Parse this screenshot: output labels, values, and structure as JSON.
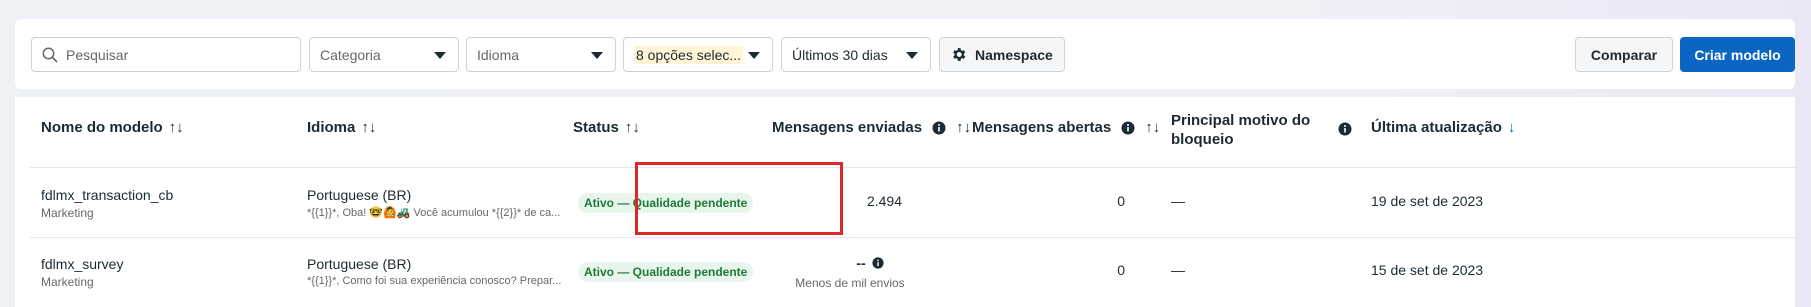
{
  "filters": {
    "search_placeholder": "Pesquisar",
    "category": "Categoria",
    "language": "Idioma",
    "status_selected": "8 opções selec...",
    "date_range": "Últimos 30 dias",
    "namespace_label": "Namespace",
    "compare_label": "Comparar",
    "create_label": "Criar modelo"
  },
  "columns": {
    "name": "Nome do modelo",
    "language": "Idioma",
    "status": "Status",
    "sent": "Mensagens enviadas",
    "opened": "Mensagens abertas",
    "block_reason": "Principal motivo do bloqueio",
    "updated": "Última atualização",
    "sort_icon": "↑↓",
    "sort_desc_icon": "↓"
  },
  "rows": [
    {
      "name": "fdlmx_transaction_cb",
      "category": "Marketing",
      "language": "Portuguese (BR)",
      "preview": "*{{1}}*, Oba! 🤓🙆🚜 Você acumulou *{{2}}* de ca...",
      "status": "Ativo — Qualidade pendente",
      "sent": "2.494",
      "sent_note": "",
      "opened": "0",
      "block_reason": "—",
      "updated": "19 de set de 2023"
    },
    {
      "name": "fdlmx_survey",
      "category": "Marketing",
      "language": "Portuguese (BR)",
      "preview": "*{{1}}*, Como foi sua experiência conosco? Prepar...",
      "status": "Ativo — Qualidade pendente",
      "sent": "--",
      "sent_note": "Menos de mil envios",
      "opened": "0",
      "block_reason": "—",
      "updated": "15 de set de 2023"
    }
  ],
  "colors": {
    "accent": "#0a66c2",
    "badge_bg": "#e7f5ea",
    "badge_text": "#1f7a3a",
    "highlight": "#e0262b"
  }
}
